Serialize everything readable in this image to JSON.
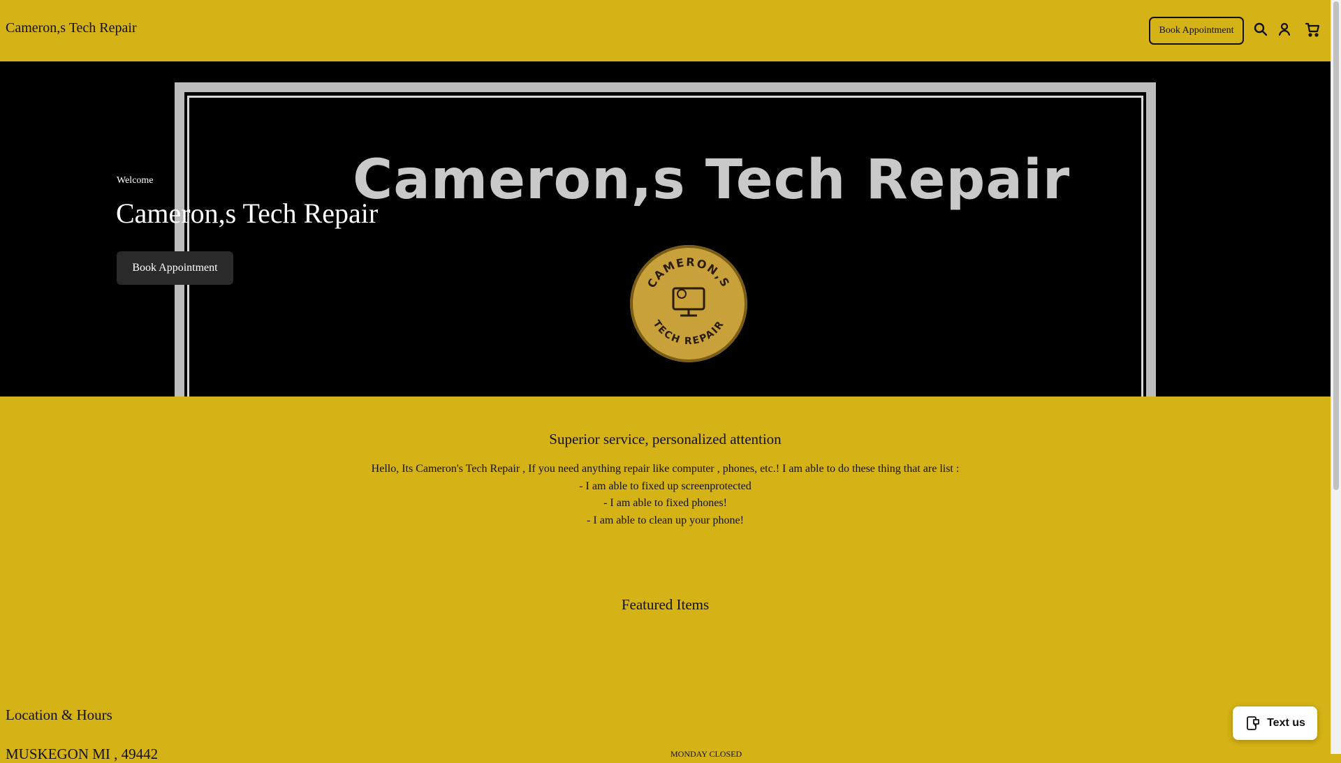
{
  "header": {
    "brand": "Cameron,s Tech Repair",
    "cta_label": "Book Appointment",
    "icons": [
      "search-icon",
      "account-icon",
      "cart-icon"
    ]
  },
  "hero": {
    "eyebrow": "Welcome",
    "title": "Cameron,s Tech Repair",
    "button_label": "Book Appointment",
    "image": {
      "logo_text": "Cameron,s Tech Repair",
      "badge_top_text": "CAMERON,S",
      "badge_bottom_text": "TECH REPAIR"
    }
  },
  "about": {
    "heading": "Superior service, personalized attention",
    "lines": [
      "Hello, Its Cameron's Tech Repair , If you need anything repair like computer , phones, etc.! I am able to do these thing that are list :",
      "- I am able to fixed up screenprotected",
      "- I am able to fixed phones!",
      "- I am able to clean up your phone!"
    ]
  },
  "featured": {
    "heading": "Featured Items"
  },
  "location": {
    "heading": "Location & Hours",
    "address": "MUSKEGON MI , 49442",
    "hours_first_line": "MONDAY CLOSED"
  },
  "chat_widget": {
    "label": "Text us"
  },
  "colors": {
    "background": "#d5b215",
    "hero_bg": "#000000",
    "button_dark": "#2a2a2a"
  }
}
